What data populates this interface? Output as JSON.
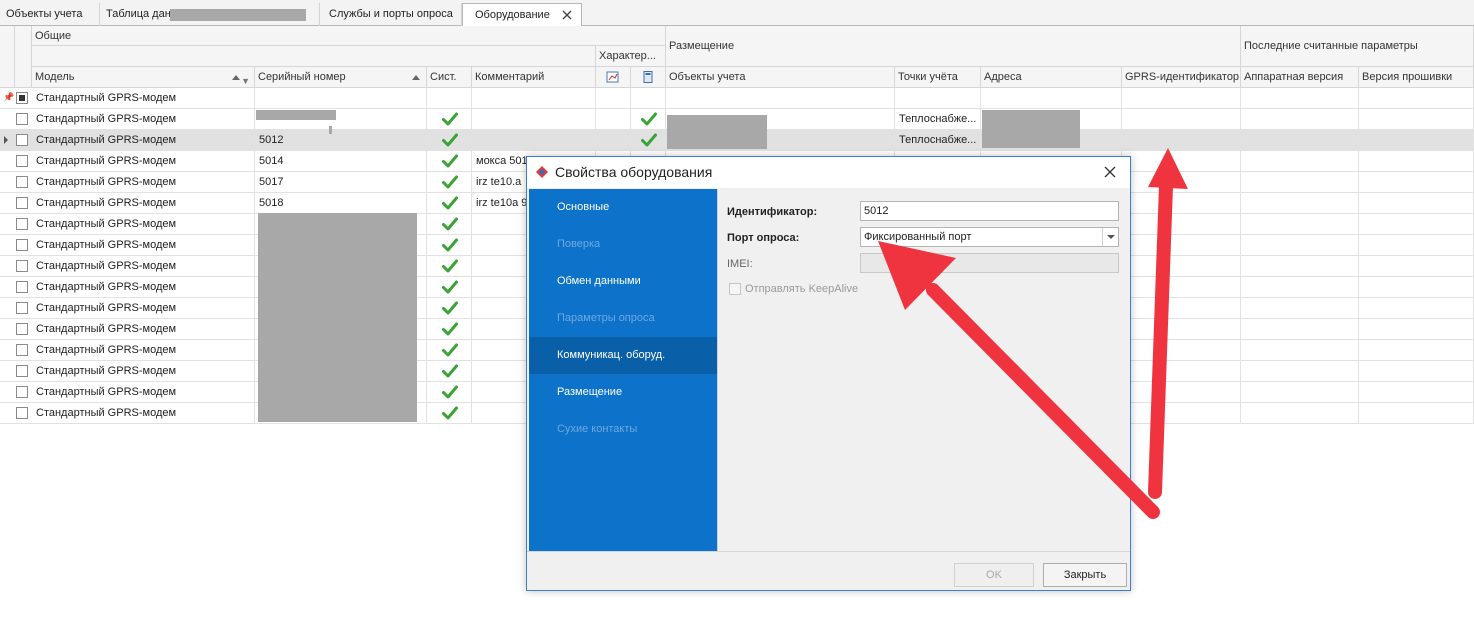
{
  "tabs": [
    {
      "label": "Объекты учета",
      "active": false
    },
    {
      "label": "Таблица дан",
      "active": false
    },
    {
      "label": "Службы и порты опроса",
      "active": false
    },
    {
      "label": "Оборудование",
      "active": true
    }
  ],
  "grid": {
    "bands": {
      "general": "Общие",
      "characteristics": "Характер...",
      "placement": "Размещение",
      "last_params": "Последние считанные параметры"
    },
    "columns": {
      "model": "Модель",
      "serial": "Серийный номер",
      "sys": "Сист.",
      "comment": "Комментарий",
      "objects": "Объекты учета",
      "points": "Точки учёта",
      "addresses": "Адреса",
      "gprs_id": "GPRS-идентификатор",
      "hw_version": "Аппаратная версия",
      "fw_version": "Версия прошивки"
    },
    "filter_row": {
      "model": "Стандартный GPRS-модем"
    },
    "rows": [
      {
        "model": "Стандартный GPRS-модем",
        "serial": "",
        "sys": true,
        "comment": "",
        "ch2": true,
        "points": "Теплоснабже...",
        "selected": false
      },
      {
        "model": "Стандартный GPRS-модем",
        "serial": "5012",
        "sys": true,
        "comment": "",
        "ch2": true,
        "points": "Теплоснабже...",
        "selected": true
      },
      {
        "model": "Стандартный GPRS-модем",
        "serial": "5014",
        "sys": true,
        "comment": "мокса 501",
        "ch2": false,
        "points": "",
        "selected": false
      },
      {
        "model": "Стандартный GPRS-модем",
        "serial": "5017",
        "sys": true,
        "comment": "irz te10.a",
        "ch2": false,
        "points": "",
        "selected": false
      },
      {
        "model": "Стандартный GPRS-модем",
        "serial": "5018",
        "sys": true,
        "comment": "irz te10a 9",
        "ch2": false,
        "points": "",
        "selected": false
      },
      {
        "model": "Стандартный GPRS-модем",
        "serial": "",
        "sys": true,
        "comment": "",
        "ch2": false,
        "points": "",
        "selected": false
      },
      {
        "model": "Стандартный GPRS-модем",
        "serial": "",
        "sys": true,
        "comment": "",
        "ch2": false,
        "points": "",
        "selected": false
      },
      {
        "model": "Стандартный GPRS-модем",
        "serial": "",
        "sys": true,
        "comment": "",
        "ch2": false,
        "points": "",
        "selected": false
      },
      {
        "model": "Стандартный GPRS-модем",
        "serial": "",
        "sys": true,
        "comment": "",
        "ch2": false,
        "points": "",
        "selected": false
      },
      {
        "model": "Стандартный GPRS-модем",
        "serial": "",
        "sys": true,
        "comment": "",
        "ch2": false,
        "points": "",
        "selected": false
      },
      {
        "model": "Стандартный GPRS-модем",
        "serial": "",
        "sys": true,
        "comment": "",
        "ch2": false,
        "points": "",
        "selected": false
      },
      {
        "model": "Стандартный GPRS-модем",
        "serial": "",
        "sys": true,
        "comment": "",
        "ch2": false,
        "points": "",
        "selected": false
      },
      {
        "model": "Стандартный GPRS-модем",
        "serial": "",
        "sys": true,
        "comment": "",
        "ch2": false,
        "points": "",
        "selected": false
      },
      {
        "model": "Стандартный GPRS-модем",
        "serial": "",
        "sys": true,
        "comment": "",
        "ch2": false,
        "points": "",
        "selected": false
      },
      {
        "model": "Стандартный GPRS-модем",
        "serial": "",
        "sys": true,
        "comment": "",
        "ch2": false,
        "points": "",
        "selected": false
      }
    ]
  },
  "dialog": {
    "title": "Свойства оборудования",
    "nav": [
      {
        "label": "Основные",
        "disabled": false,
        "active": false
      },
      {
        "label": "Поверка",
        "disabled": true,
        "active": false
      },
      {
        "label": "Обмен данными",
        "disabled": false,
        "active": false
      },
      {
        "label": "Параметры опроса",
        "disabled": true,
        "active": false
      },
      {
        "label": "Коммуникац. оборуд.",
        "disabled": false,
        "active": true
      },
      {
        "label": "Размещение",
        "disabled": false,
        "active": false
      },
      {
        "label": "Сухие контакты",
        "disabled": true,
        "active": false
      }
    ],
    "fields": {
      "id_label": "Идентификатор:",
      "id_value": "5012",
      "port_label": "Порт опроса:",
      "port_value": "Фиксированный порт",
      "imei_label": "IMEI:",
      "imei_value": "",
      "keepalive_label": "Отправлять KeepAlive"
    },
    "buttons": {
      "ok": "OK",
      "close": "Закрыть"
    }
  },
  "colors": {
    "accent": "#0d72c9",
    "check": "#3aa335",
    "arrow": "#f0343f"
  }
}
